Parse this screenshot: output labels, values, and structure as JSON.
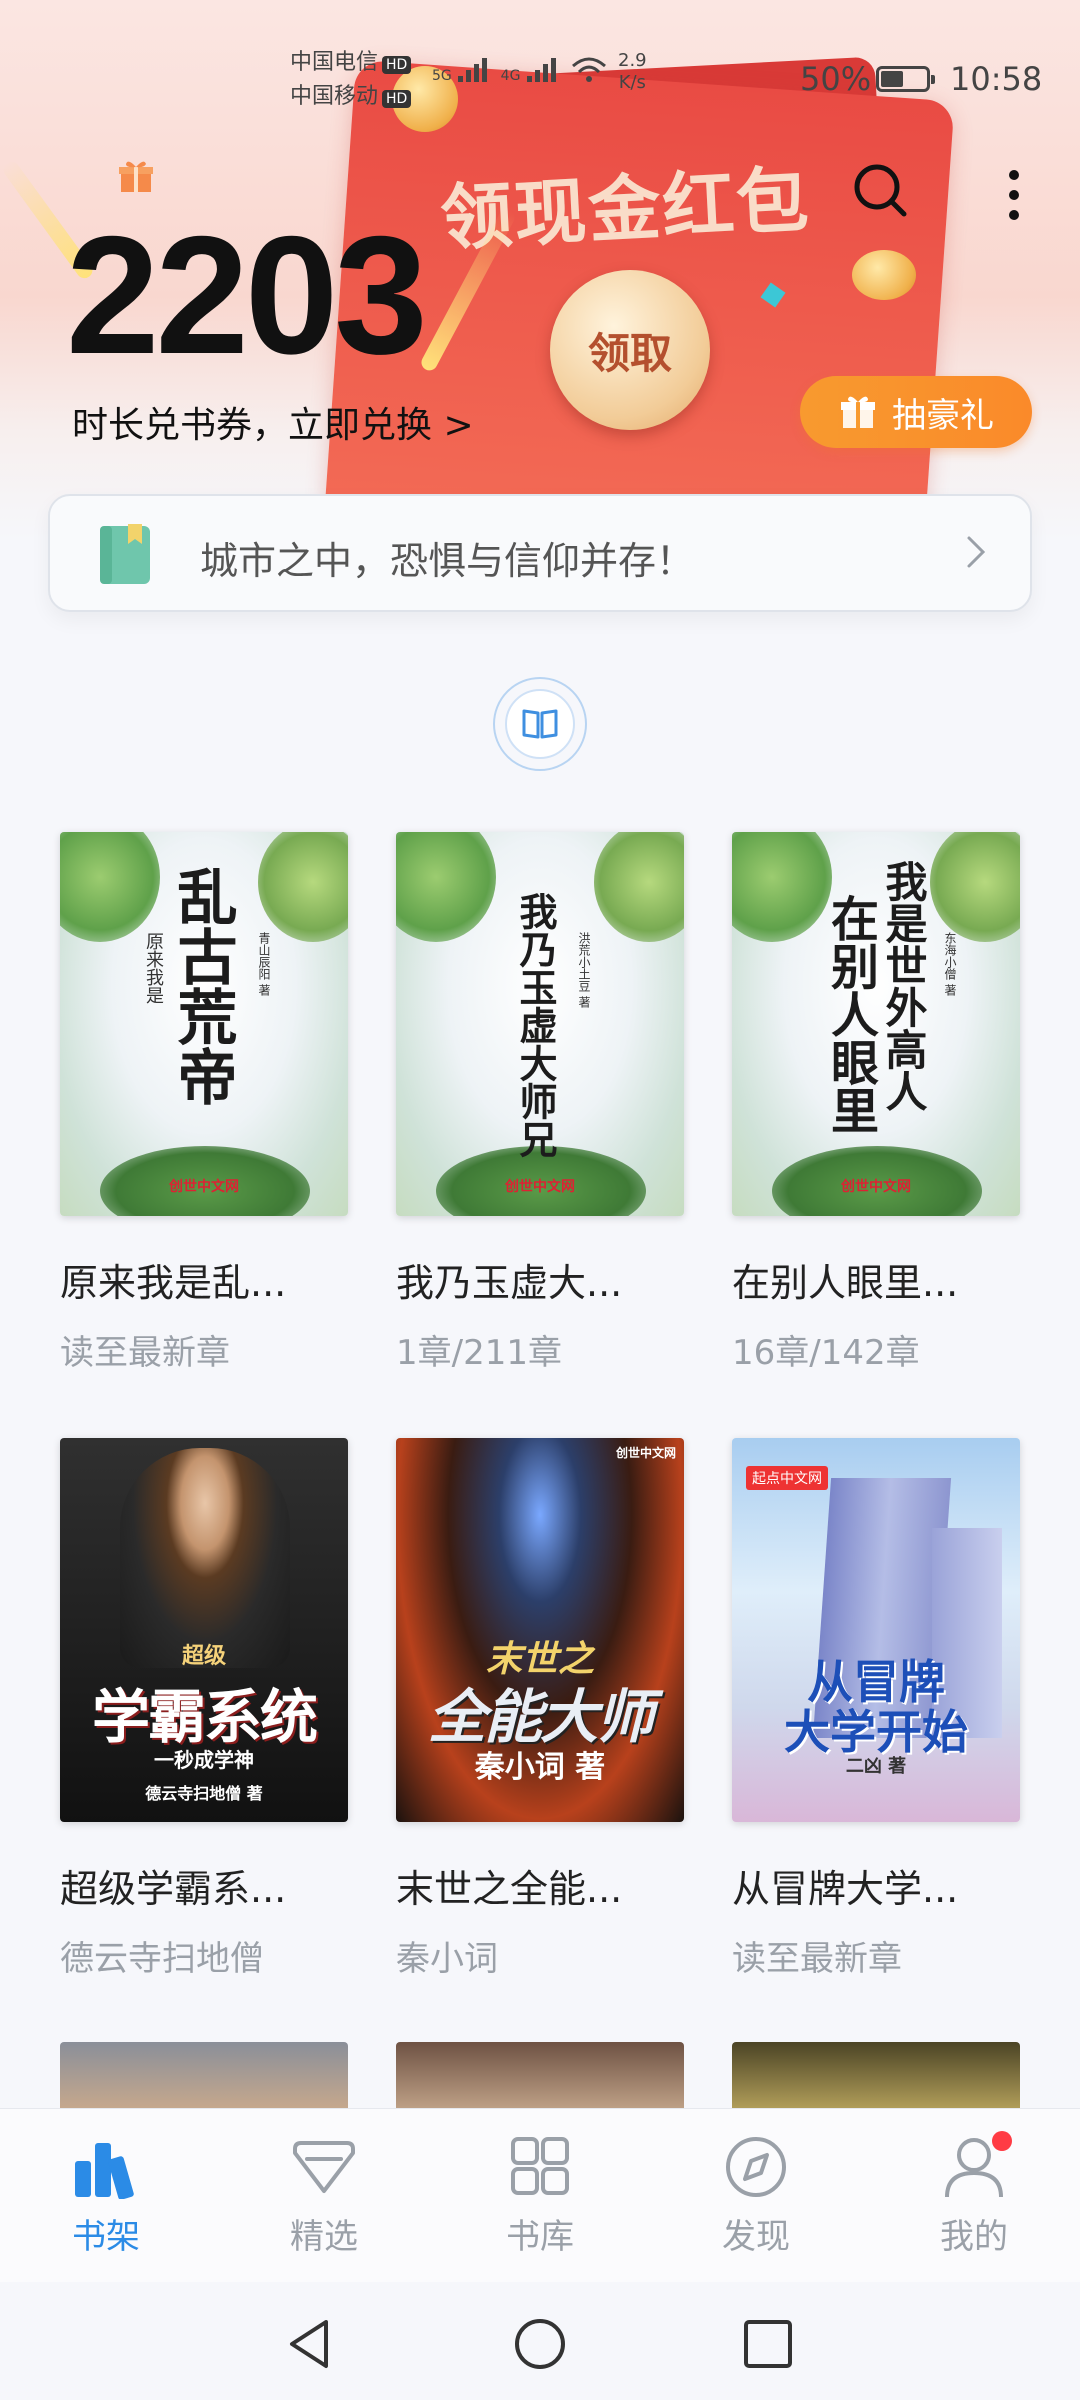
{
  "status_bar": {
    "carrier1": "中国电信",
    "carrier2": "中国移动",
    "hd": "HD",
    "net1": "5G",
    "net2": "4G",
    "speed_value": "2.9",
    "speed_unit": "K/s",
    "battery_pct": "50%",
    "time": "10:58"
  },
  "banner": {
    "title": "领现金红包",
    "claim_label": "领取",
    "minutes": "2203",
    "redeem_text": "时长兑书券，立即兑换 >",
    "lottery_label": "抽豪礼"
  },
  "notice": {
    "text": "城市之中，恐惧与信仰并存！"
  },
  "books": [
    {
      "title": "原来我是乱...",
      "progress": "读至最新章",
      "cover": {
        "vertical_title": "乱古荒帝",
        "side_text": "原来我是",
        "author_text": "青山辰阳 著",
        "brand": "创世中文网"
      }
    },
    {
      "title": "我乃玉虚大...",
      "progress": "1章/211章",
      "cover": {
        "vertical_title": "我乃玉虚大师兄",
        "author_text": "洪荒小土豆 著",
        "brand": "创世中文网"
      }
    },
    {
      "title": "在别人眼里...",
      "progress": "16章/142章",
      "cover": {
        "vertical_title_a": "我是世外高人",
        "vertical_title_b": "在别人眼里",
        "author_text": "东海小僧 著",
        "brand": "创世中文网"
      }
    },
    {
      "title": "超级学霸系...",
      "progress": "德云寺扫地僧",
      "cover": {
        "tag": "超级",
        "main": "学霸系统",
        "sub": "一秒成学神",
        "author": "德云寺扫地僧 著"
      }
    },
    {
      "title": "末世之全能...",
      "progress": "秦小词",
      "cover": {
        "line1": "末世之",
        "line2": "全能大师",
        "author": "秦小词 著",
        "brand": "创世中文网"
      }
    },
    {
      "title": "从冒牌大学...",
      "progress": "读至最新章",
      "cover": {
        "brand": "起点中文网",
        "line1": "从冒牌",
        "line2": "大学开始",
        "author": "二凶 著"
      }
    }
  ],
  "tabs": [
    {
      "label": "书架",
      "icon": "bookshelf-icon",
      "active": true
    },
    {
      "label": "精选",
      "icon": "diamond-icon",
      "active": false
    },
    {
      "label": "书库",
      "icon": "grid-icon",
      "active": false
    },
    {
      "label": "发现",
      "icon": "compass-icon",
      "active": false
    },
    {
      "label": "我的",
      "icon": "person-icon",
      "active": false
    }
  ],
  "colors": {
    "accent": "#2b8be6",
    "envelope": "#e94b44",
    "lottery": "#f89a2f",
    "notification_dot": "#ff3b44"
  }
}
